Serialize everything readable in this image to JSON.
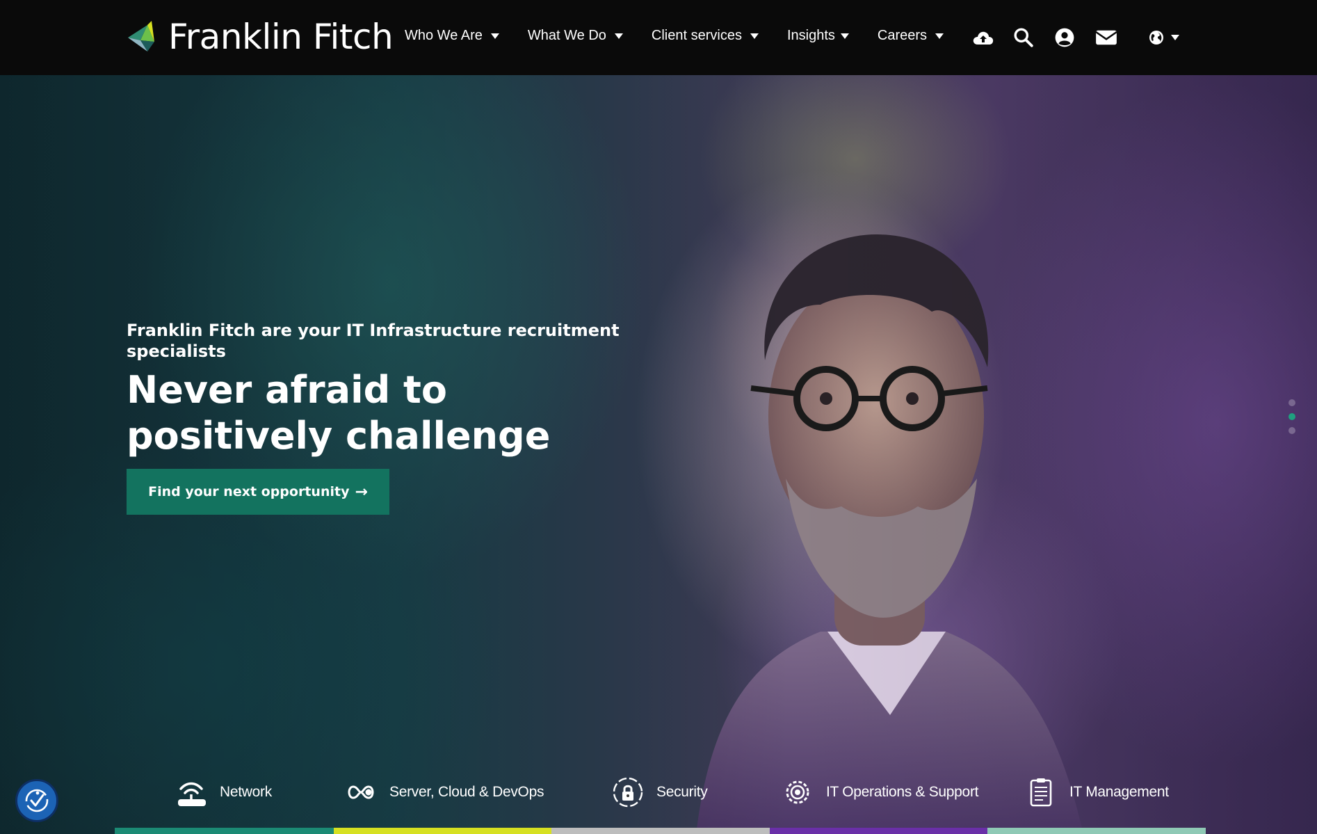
{
  "brand": {
    "name": "Franklin Fitch"
  },
  "nav": {
    "items": [
      {
        "label": "Who We Are"
      },
      {
        "label": "What We Do"
      },
      {
        "label": "Client services"
      },
      {
        "label": "Insights"
      },
      {
        "label": "Careers"
      }
    ],
    "icons": [
      "upload-cloud-icon",
      "search-icon",
      "user-account-icon",
      "envelope-icon",
      "globe-icon"
    ]
  },
  "hero": {
    "subtitle": "Franklin Fitch are your IT Infrastructure recruitment specialists",
    "headline": "Never afraid to positively challenge",
    "cta_label": "Find your next opportunity",
    "slides": {
      "count": 3,
      "active": 2
    }
  },
  "categories": [
    {
      "label": "Network",
      "icon": "router-icon",
      "color": "#1b8a74"
    },
    {
      "label": "Server, Cloud & DevOps",
      "icon": "infinity-loop-icon",
      "color": "#d6e021"
    },
    {
      "label": "Security",
      "icon": "padlock-icon",
      "color": "#bdbdbd"
    },
    {
      "label": "IT Operations & Support",
      "icon": "gear-icon",
      "color": "#6a2fa8"
    },
    {
      "label": "IT Management",
      "icon": "clipboard-icon",
      "color": "#8fc9b5"
    }
  ],
  "colors": {
    "nav_bg": "#0a0a0a",
    "cta_bg": "#13735f",
    "accent": "#1fa07f"
  }
}
